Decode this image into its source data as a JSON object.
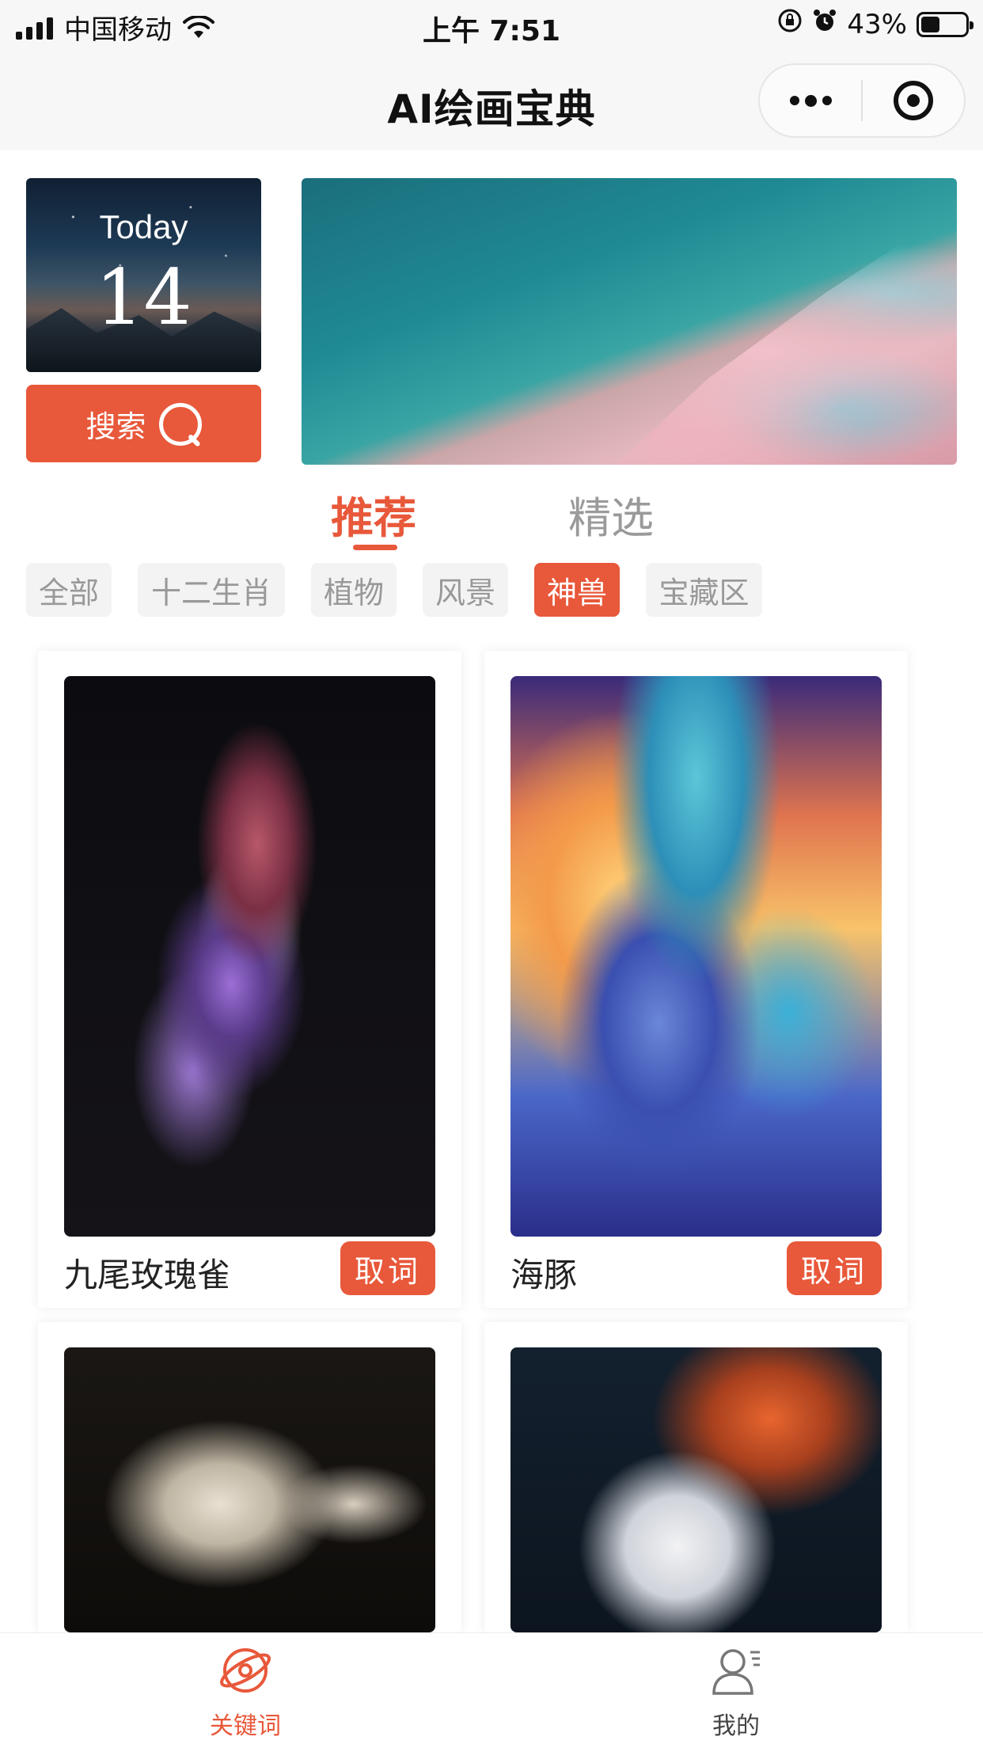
{
  "status_bar": {
    "carrier": "中国移动",
    "time": "上午 7:51",
    "battery": "43%",
    "battery_level": 0.43
  },
  "navbar": {
    "title": "AI绘画宝典",
    "more_icon": "more-dots-icon",
    "close_icon": "target-circle-icon"
  },
  "today_card": {
    "label": "Today",
    "day": "14"
  },
  "search_button": {
    "label": "搜索",
    "icon": "search-icon"
  },
  "main_tabs": [
    {
      "label": "推荐",
      "active": true
    },
    {
      "label": "精选",
      "active": false
    }
  ],
  "categories": [
    {
      "label": "全部",
      "active": false
    },
    {
      "label": "十二生肖",
      "active": false
    },
    {
      "label": "植物",
      "active": false
    },
    {
      "label": "风景",
      "active": false
    },
    {
      "label": "神兽",
      "active": true
    },
    {
      "label": "宝藏区",
      "active": false
    }
  ],
  "cards": [
    {
      "name": "九尾玫瑰雀",
      "action": "取词"
    },
    {
      "name": "海豚",
      "action": "取词"
    },
    {
      "name": "",
      "action": ""
    },
    {
      "name": "",
      "action": ""
    }
  ],
  "tabbar": [
    {
      "label": "关键词",
      "icon": "planet-icon",
      "active": true
    },
    {
      "label": "我的",
      "icon": "user-icon",
      "active": false
    }
  ],
  "colors": {
    "accent": "#e8583a",
    "chip_bg": "#f3f3f3",
    "muted_text": "#999999"
  }
}
